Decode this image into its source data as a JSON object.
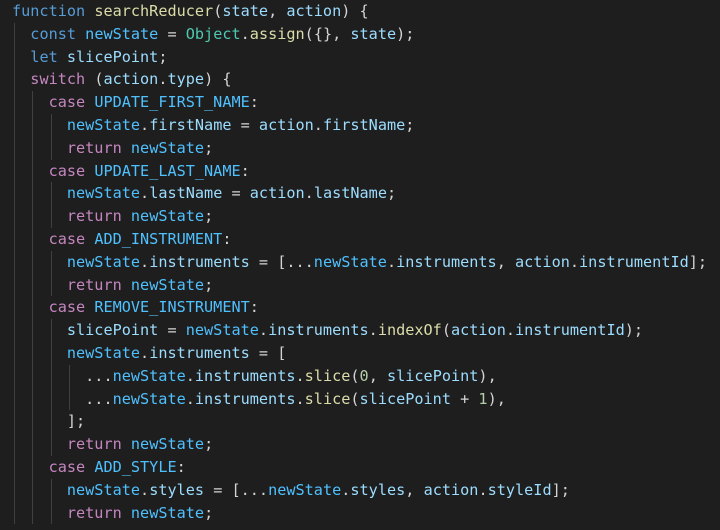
{
  "editor": {
    "colors": {
      "background": "#1e1e1e",
      "text": "#d4d4d4",
      "keyword": "#569cd6",
      "control": "#c586c0",
      "function": "#dcdcaa",
      "variable": "#9cdcfe",
      "class": "#4ec9b0",
      "number": "#b5cea8",
      "constant": "#4fc1ff"
    },
    "lines": [
      {
        "indent": 0,
        "tokens": [
          [
            "kw",
            "function"
          ],
          [
            "pun",
            " "
          ],
          [
            "fn",
            "searchReducer"
          ],
          [
            "pun",
            "("
          ],
          [
            "var",
            "state"
          ],
          [
            "pun",
            ", "
          ],
          [
            "var",
            "action"
          ],
          [
            "pun",
            ") {"
          ]
        ]
      },
      {
        "indent": 1,
        "tokens": [
          [
            "kw",
            "const"
          ],
          [
            "pun",
            " "
          ],
          [
            "cst",
            "newState"
          ],
          [
            "pun",
            " = "
          ],
          [
            "cls",
            "Object"
          ],
          [
            "pun",
            "."
          ],
          [
            "fn",
            "assign"
          ],
          [
            "pun",
            "({}, "
          ],
          [
            "var",
            "state"
          ],
          [
            "pun",
            ");"
          ]
        ]
      },
      {
        "indent": 1,
        "tokens": [
          [
            "kw",
            "let"
          ],
          [
            "pun",
            " "
          ],
          [
            "var",
            "slicePoint"
          ],
          [
            "pun",
            ";"
          ]
        ]
      },
      {
        "indent": 1,
        "tokens": [
          [
            "ctl",
            "switch"
          ],
          [
            "pun",
            " ("
          ],
          [
            "var",
            "action"
          ],
          [
            "pun",
            "."
          ],
          [
            "var",
            "type"
          ],
          [
            "pun",
            ") {"
          ]
        ]
      },
      {
        "indent": 2,
        "tokens": [
          [
            "ctl",
            "case"
          ],
          [
            "pun",
            " "
          ],
          [
            "cst",
            "UPDATE_FIRST_NAME"
          ],
          [
            "pun",
            ":"
          ]
        ]
      },
      {
        "indent": 3,
        "tokens": [
          [
            "cst",
            "newState"
          ],
          [
            "pun",
            "."
          ],
          [
            "var",
            "firstName"
          ],
          [
            "pun",
            " = "
          ],
          [
            "var",
            "action"
          ],
          [
            "pun",
            "."
          ],
          [
            "var",
            "firstName"
          ],
          [
            "pun",
            ";"
          ]
        ]
      },
      {
        "indent": 3,
        "tokens": [
          [
            "ctl",
            "return"
          ],
          [
            "pun",
            " "
          ],
          [
            "cst",
            "newState"
          ],
          [
            "pun",
            ";"
          ]
        ]
      },
      {
        "indent": 2,
        "tokens": [
          [
            "ctl",
            "case"
          ],
          [
            "pun",
            " "
          ],
          [
            "cst",
            "UPDATE_LAST_NAME"
          ],
          [
            "pun",
            ":"
          ]
        ]
      },
      {
        "indent": 3,
        "tokens": [
          [
            "cst",
            "newState"
          ],
          [
            "pun",
            "."
          ],
          [
            "var",
            "lastName"
          ],
          [
            "pun",
            " = "
          ],
          [
            "var",
            "action"
          ],
          [
            "pun",
            "."
          ],
          [
            "var",
            "lastName"
          ],
          [
            "pun",
            ";"
          ]
        ]
      },
      {
        "indent": 3,
        "tokens": [
          [
            "ctl",
            "return"
          ],
          [
            "pun",
            " "
          ],
          [
            "cst",
            "newState"
          ],
          [
            "pun",
            ";"
          ]
        ]
      },
      {
        "indent": 2,
        "tokens": [
          [
            "ctl",
            "case"
          ],
          [
            "pun",
            " "
          ],
          [
            "cst",
            "ADD_INSTRUMENT"
          ],
          [
            "pun",
            ":"
          ]
        ]
      },
      {
        "indent": 3,
        "tokens": [
          [
            "cst",
            "newState"
          ],
          [
            "pun",
            "."
          ],
          [
            "var",
            "instruments"
          ],
          [
            "pun",
            " = [..."
          ],
          [
            "cst",
            "newState"
          ],
          [
            "pun",
            "."
          ],
          [
            "var",
            "instruments"
          ],
          [
            "pun",
            ", "
          ],
          [
            "var",
            "action"
          ],
          [
            "pun",
            "."
          ],
          [
            "var",
            "instrumentId"
          ],
          [
            "pun",
            "];"
          ]
        ]
      },
      {
        "indent": 3,
        "tokens": [
          [
            "ctl",
            "return"
          ],
          [
            "pun",
            " "
          ],
          [
            "cst",
            "newState"
          ],
          [
            "pun",
            ";"
          ]
        ]
      },
      {
        "indent": 2,
        "tokens": [
          [
            "ctl",
            "case"
          ],
          [
            "pun",
            " "
          ],
          [
            "cst",
            "REMOVE_INSTRUMENT"
          ],
          [
            "pun",
            ":"
          ]
        ]
      },
      {
        "indent": 3,
        "tokens": [
          [
            "var",
            "slicePoint"
          ],
          [
            "pun",
            " = "
          ],
          [
            "cst",
            "newState"
          ],
          [
            "pun",
            "."
          ],
          [
            "var",
            "instruments"
          ],
          [
            "pun",
            "."
          ],
          [
            "fn",
            "indexOf"
          ],
          [
            "pun",
            "("
          ],
          [
            "var",
            "action"
          ],
          [
            "pun",
            "."
          ],
          [
            "var",
            "instrumentId"
          ],
          [
            "pun",
            ");"
          ]
        ]
      },
      {
        "indent": 3,
        "tokens": [
          [
            "cst",
            "newState"
          ],
          [
            "pun",
            "."
          ],
          [
            "var",
            "instruments"
          ],
          [
            "pun",
            " = ["
          ]
        ]
      },
      {
        "indent": 4,
        "tokens": [
          [
            "pun",
            "..."
          ],
          [
            "cst",
            "newState"
          ],
          [
            "pun",
            "."
          ],
          [
            "var",
            "instruments"
          ],
          [
            "pun",
            "."
          ],
          [
            "fn",
            "slice"
          ],
          [
            "pun",
            "("
          ],
          [
            "num",
            "0"
          ],
          [
            "pun",
            ", "
          ],
          [
            "var",
            "slicePoint"
          ],
          [
            "pun",
            "),"
          ]
        ]
      },
      {
        "indent": 4,
        "tokens": [
          [
            "pun",
            "..."
          ],
          [
            "cst",
            "newState"
          ],
          [
            "pun",
            "."
          ],
          [
            "var",
            "instruments"
          ],
          [
            "pun",
            "."
          ],
          [
            "fn",
            "slice"
          ],
          [
            "pun",
            "("
          ],
          [
            "var",
            "slicePoint"
          ],
          [
            "pun",
            " + "
          ],
          [
            "num",
            "1"
          ],
          [
            "pun",
            "),"
          ]
        ]
      },
      {
        "indent": 3,
        "tokens": [
          [
            "pun",
            "];"
          ]
        ]
      },
      {
        "indent": 3,
        "tokens": [
          [
            "ctl",
            "return"
          ],
          [
            "pun",
            " "
          ],
          [
            "cst",
            "newState"
          ],
          [
            "pun",
            ";"
          ]
        ]
      },
      {
        "indent": 2,
        "tokens": [
          [
            "ctl",
            "case"
          ],
          [
            "pun",
            " "
          ],
          [
            "cst",
            "ADD_STYLE"
          ],
          [
            "pun",
            ":"
          ]
        ]
      },
      {
        "indent": 3,
        "tokens": [
          [
            "cst",
            "newState"
          ],
          [
            "pun",
            "."
          ],
          [
            "var",
            "styles"
          ],
          [
            "pun",
            " = [..."
          ],
          [
            "cst",
            "newState"
          ],
          [
            "pun",
            "."
          ],
          [
            "var",
            "styles"
          ],
          [
            "pun",
            ", "
          ],
          [
            "var",
            "action"
          ],
          [
            "pun",
            "."
          ],
          [
            "var",
            "styleId"
          ],
          [
            "pun",
            "];"
          ]
        ]
      },
      {
        "indent": 3,
        "tokens": [
          [
            "ctl",
            "return"
          ],
          [
            "pun",
            " "
          ],
          [
            "cst",
            "newState"
          ],
          [
            "pun",
            ";"
          ]
        ]
      }
    ]
  }
}
